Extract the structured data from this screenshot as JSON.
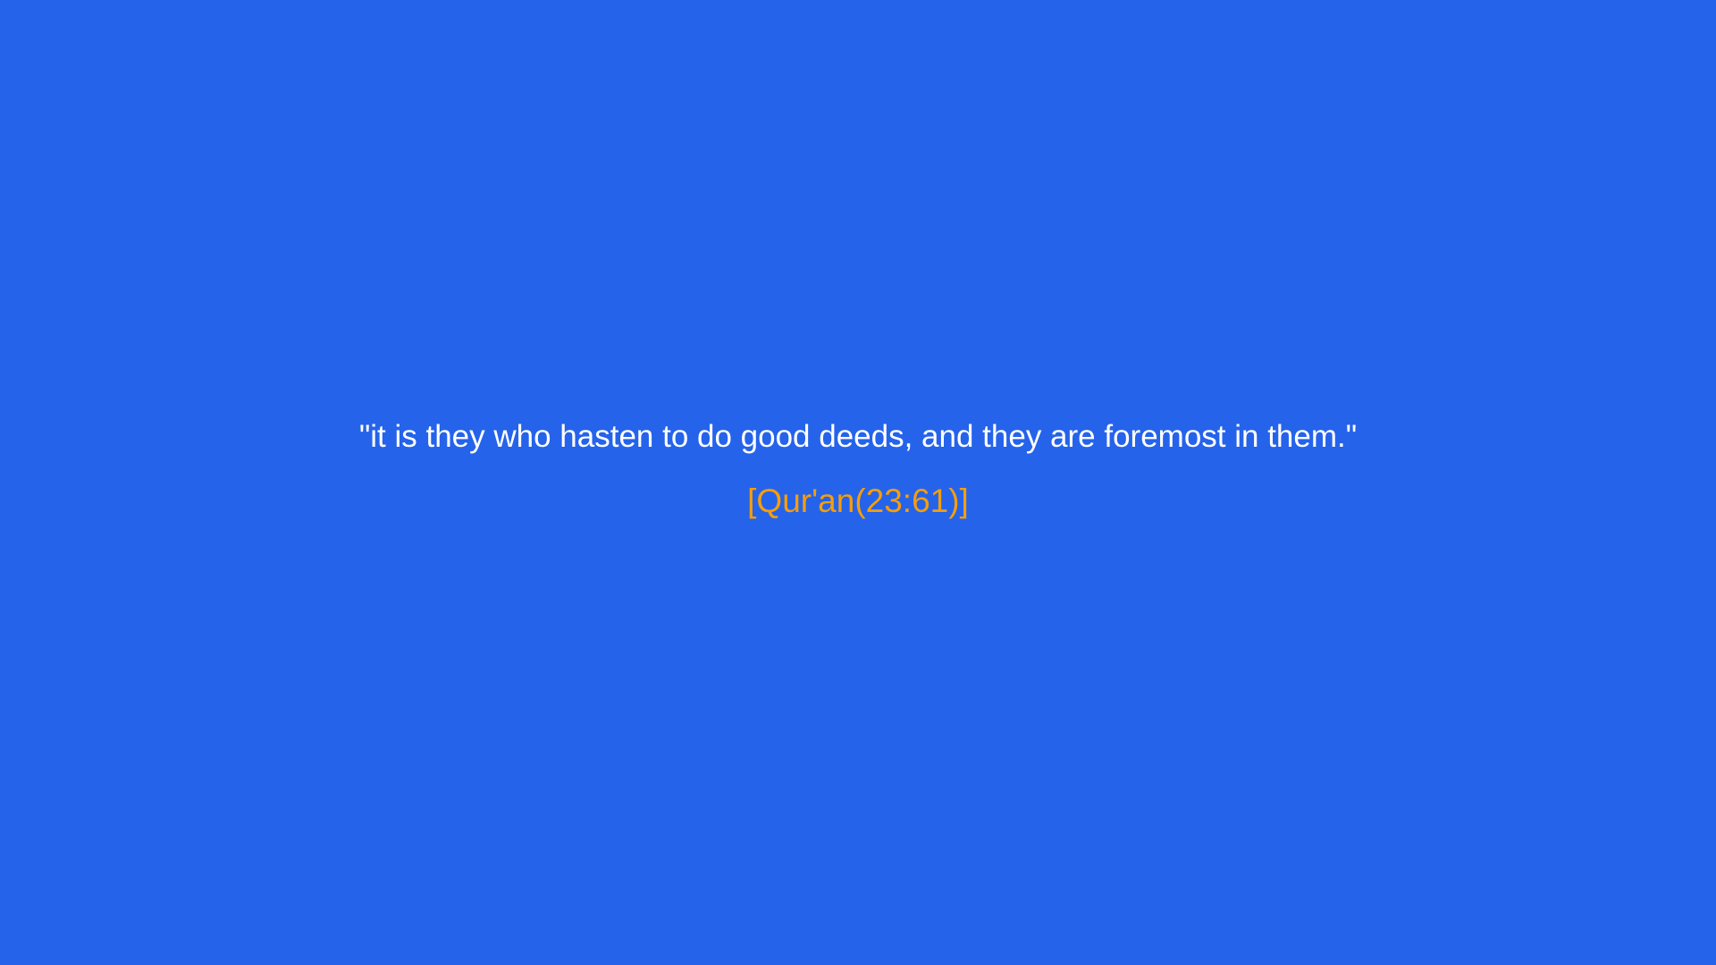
{
  "quote": {
    "text": "\"it is they who hasten to do good deeds, and they are foremost in them.\"",
    "source": "[Qur'an(23:61)]"
  },
  "colors": {
    "background": "#2563EB",
    "quote_text": "#FFFFFF",
    "source_text": "#F59E0B"
  }
}
